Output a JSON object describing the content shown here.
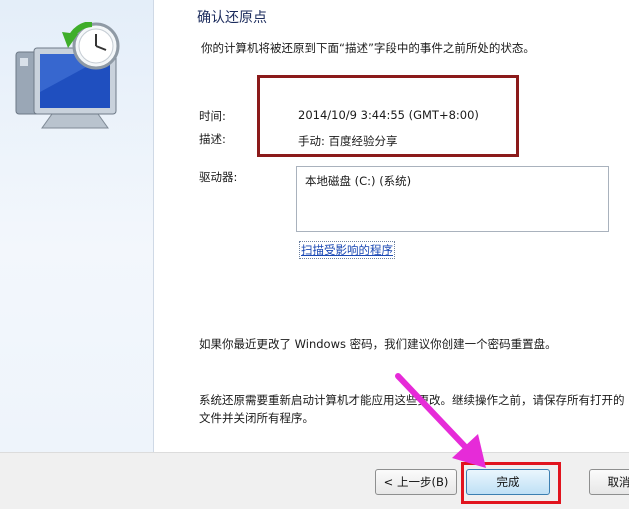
{
  "dialog": {
    "title": "确认还原点",
    "subtitle": "你的计算机将被还原到下面“描述”字段中的事件之前所处的状态。",
    "time_label": "时间:",
    "time_value": "2014/10/9 3:44:55 (GMT+8:00)",
    "desc_label": "描述:",
    "desc_value": "手动: 百度经验分享",
    "drives_label": "驱动器:",
    "drives": [
      "本地磁盘 (C:) (系统)"
    ],
    "scan_link": "扫描受影响的程序",
    "password_note": "如果你最近更改了 Windows 密码，我们建议你创建一个密码重置盘。",
    "restart_note": "系统还原需要重新启动计算机才能应用这些更改。继续操作之前，请保存所有打开的文件并关闭所有程序。"
  },
  "buttons": {
    "back": "< 上一步(B)",
    "finish": "完成",
    "cancel": "取消"
  },
  "colors": {
    "highlight_box": "#8b1a1a",
    "finish_box": "#e1141e",
    "arrow": "#e62bd8",
    "link": "#1a48b4"
  },
  "icons": [
    "system-restore-icon"
  ]
}
